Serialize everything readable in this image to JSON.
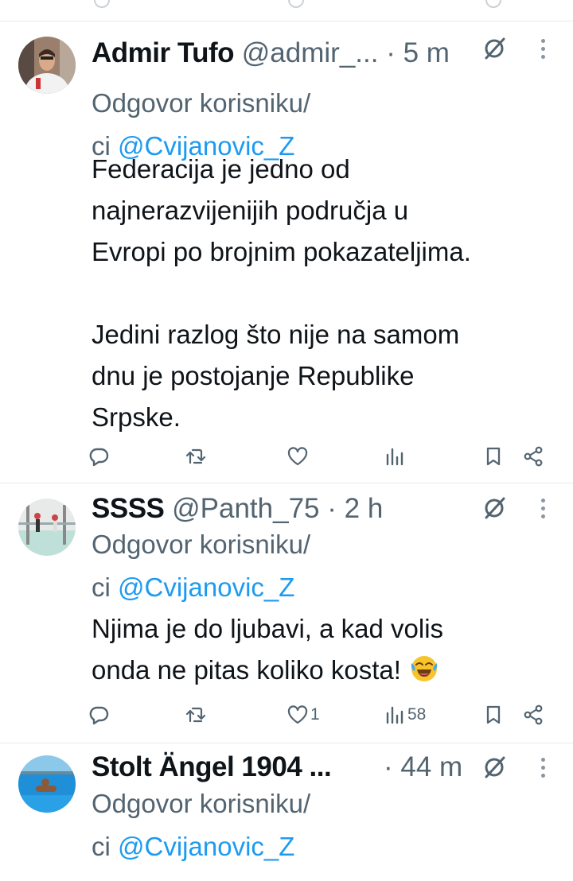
{
  "tweets": [
    {
      "name": "Admir Tufo",
      "handle": "@admir_...",
      "time": "5 m",
      "reply_prefix": "Odgovor korisniku/",
      "reply_prefix2": "ci",
      "reply_mention": "@Cvijanovic_Z",
      "text": "Federacija je jedno od\nnajnerazvijenijih područja u\nEvropi po brojnim pokazateljima.\n\nJedini razlog što nije na samom\ndnu je postojanje Republike\nSrpske.",
      "likes": "",
      "views": ""
    },
    {
      "name": "SSSS",
      "handle": "@Panth_75",
      "time": "2 h",
      "reply_prefix": "Odgovor korisniku/",
      "reply_prefix2": "ci",
      "reply_mention": "@Cvijanovic_Z",
      "text": "Njima je do ljubavi, a kad volis\nonda ne pitas koliko kosta!",
      "likes": "1",
      "views": "58"
    },
    {
      "name": "Stolt Ängel 1904 ...",
      "handle": "",
      "time": "44 m",
      "reply_prefix": "Odgovor korisniku/",
      "reply_prefix2": "ci",
      "reply_mention": "@Cvijanovic_Z"
    }
  ],
  "dot": "·",
  "colors": {
    "accent": "#1d9bf0",
    "muted": "#536471",
    "text": "#0f1419"
  },
  "icons": [
    "reply-icon",
    "retweet-icon",
    "like-icon",
    "views-icon",
    "bookmark-icon",
    "share-icon",
    "grok-icon",
    "more-icon"
  ]
}
